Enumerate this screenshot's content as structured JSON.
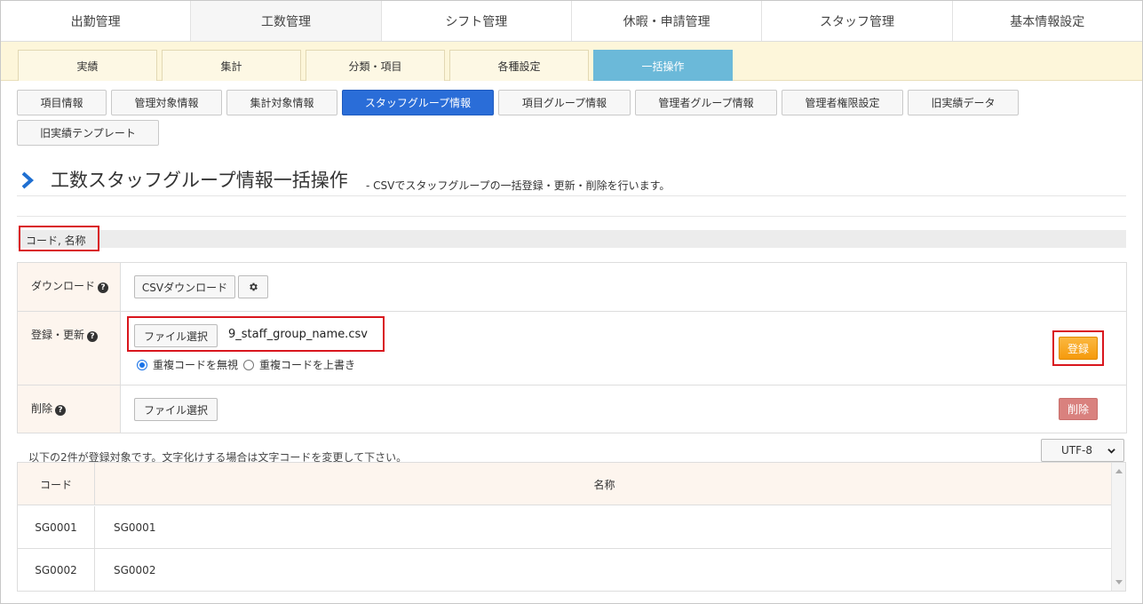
{
  "top_nav": {
    "tabs": [
      {
        "label": "出勤管理"
      },
      {
        "label": "工数管理"
      },
      {
        "label": "シフト管理"
      },
      {
        "label": "休暇・申請管理"
      },
      {
        "label": "スタッフ管理"
      },
      {
        "label": "基本情報設定"
      }
    ],
    "active_index": 1
  },
  "sub_nav": {
    "tabs": [
      {
        "label": "実績"
      },
      {
        "label": "集計"
      },
      {
        "label": "分類・項目"
      },
      {
        "label": "各種設定"
      },
      {
        "label": "一括操作"
      }
    ],
    "active_index": 4
  },
  "category_buttons": [
    {
      "label": "項目情報"
    },
    {
      "label": "管理対象情報"
    },
    {
      "label": "集計対象情報"
    },
    {
      "label": "スタッフグループ情報"
    },
    {
      "label": "項目グループ情報"
    },
    {
      "label": "管理者グループ情報"
    },
    {
      "label": "管理者権限設定"
    },
    {
      "label": "旧実績データ"
    },
    {
      "label": "旧実績テンプレート"
    }
  ],
  "active_category_index": 3,
  "page": {
    "title": "工数スタッフグループ情報一括操作",
    "subtitle": "- CSVでスタッフグループの一括登録・更新・削除を行います。"
  },
  "fields_bar": {
    "label": "コード, 名称"
  },
  "form": {
    "download": {
      "label": "ダウンロード",
      "csv_button": "CSVダウンロード",
      "settings_icon": "gear-icon"
    },
    "register": {
      "label": "登録・更新",
      "file_button": "ファイル選択",
      "file_name": "9_staff_group_name.csv",
      "option_ignore": "重複コードを無視",
      "option_overwrite": "重複コードを上書き",
      "selected_option": "ignore",
      "submit_button": "登録"
    },
    "delete": {
      "label": "削除",
      "file_button": "ファイル選択",
      "submit_button": "削除"
    },
    "help_icon": "question-icon"
  },
  "info_text": "以下の2件が登録対象です。文字化けする場合は文字コードを変更して下さい。",
  "encoding_select": {
    "value": "UTF-8"
  },
  "table": {
    "headers": [
      "コード",
      "名称"
    ],
    "rows": [
      [
        "SG0001",
        "SG0001"
      ],
      [
        "SG0002",
        "SG0002"
      ]
    ]
  },
  "colors": {
    "accent_blue": "#2a6dd8",
    "sub_active": "#6bb9d9",
    "register_orange": "#f59a0c",
    "delete_red": "#d9817e",
    "highlight_red": "#d9161d"
  }
}
